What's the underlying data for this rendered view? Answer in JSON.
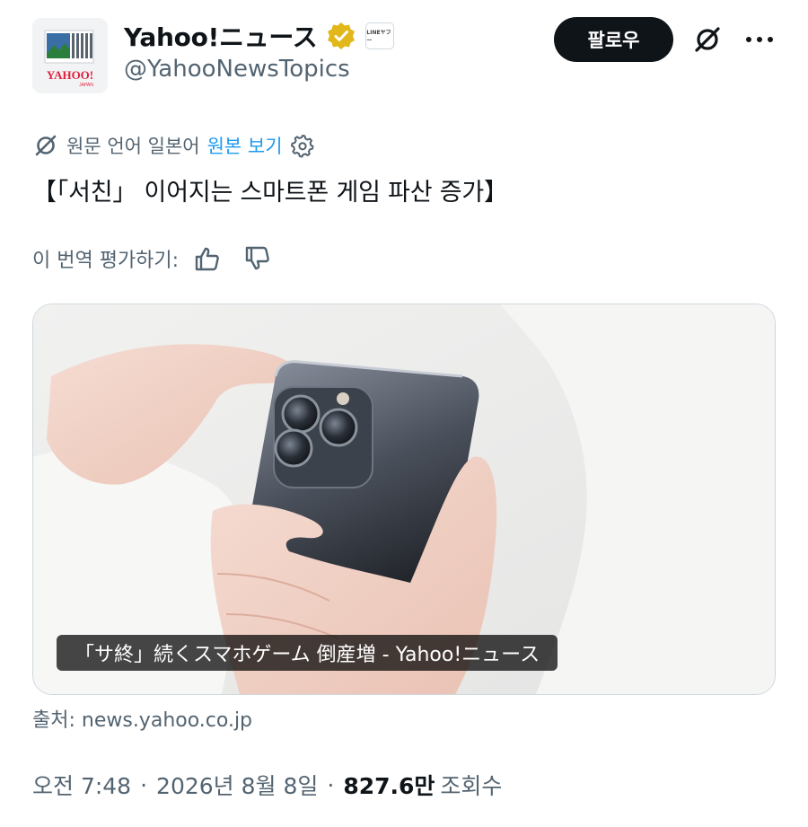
{
  "header": {
    "display_name": "Yahoo!ニュース",
    "handle": "@YahooNewsTopics",
    "affiliate_badge_text": "LINEヤフー",
    "avatar_logo_text": "YAHOO!",
    "avatar_logo_subtext": "JAPAN",
    "follow_label": "팔로우",
    "verified_color": "#e2b719"
  },
  "translation": {
    "original_language_label": "원문 언어 일본어",
    "view_original_label": "원본 보기"
  },
  "tweet_text": "【「서친」 이어지는 스마트폰 게임 파산 증가】",
  "rating": {
    "prompt": "이 번역 평가하기:"
  },
  "card": {
    "caption": "「サ終」続くスマホゲーム 倒産増 - Yahoo!ニュース",
    "source": "출처: news.yahoo.co.jp"
  },
  "meta": {
    "time": "오전 7:48",
    "date": "2026년 8월 8일",
    "views_count": "827.6만",
    "views_label": "조회수",
    "separator": "·"
  },
  "icons": {
    "grok": "slashed-circle-icon",
    "more": "more-dots-icon",
    "translate": "translate-icon",
    "settings": "gear-icon",
    "thumbs_up": "thumbs-up-icon",
    "thumbs_down": "thumbs-down-icon"
  },
  "colors": {
    "accent": "#1d9bf0",
    "text": "#0f1419",
    "secondary": "#536471"
  }
}
